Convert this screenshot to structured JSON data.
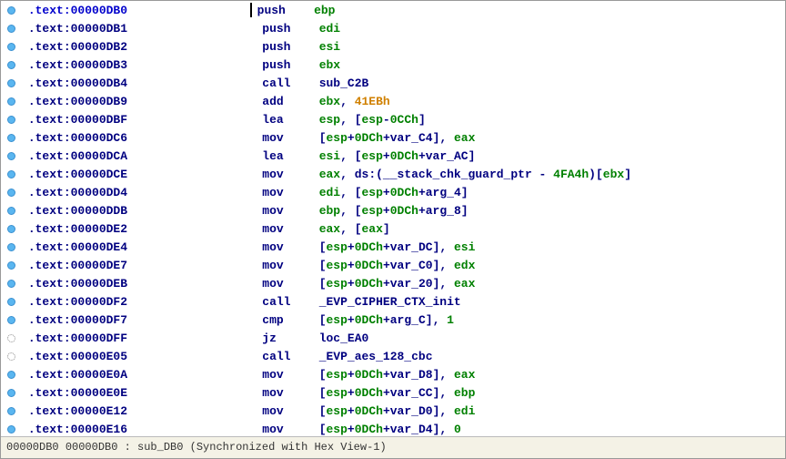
{
  "status": {
    "addr1": "00000DB0",
    "addr2": "00000DB0",
    "func": "sub_DB0",
    "sync": "(Synchronized with Hex View-1)"
  },
  "lines": [
    {
      "bp": "dot",
      "cursor": true,
      "addr": ".text:00000DB0",
      "op": "push",
      "args": [
        {
          "t": "reg",
          "v": "ebp"
        }
      ]
    },
    {
      "bp": "dot",
      "addr": ".text:00000DB1",
      "op": "push",
      "args": [
        {
          "t": "reg",
          "v": "edi"
        }
      ]
    },
    {
      "bp": "dot",
      "addr": ".text:00000DB2",
      "op": "push",
      "args": [
        {
          "t": "reg",
          "v": "esi"
        }
      ]
    },
    {
      "bp": "dot",
      "addr": ".text:00000DB3",
      "op": "push",
      "args": [
        {
          "t": "reg",
          "v": "ebx"
        }
      ]
    },
    {
      "bp": "dot",
      "addr": ".text:00000DB4",
      "op": "call",
      "args": [
        {
          "t": "name",
          "v": "sub_C2B"
        }
      ]
    },
    {
      "bp": "dot",
      "addr": ".text:00000DB9",
      "op": "add",
      "args": [
        {
          "t": "reg",
          "v": "ebx"
        },
        {
          "t": "p",
          "v": ", "
        },
        {
          "t": "orange",
          "v": "41EBh"
        }
      ]
    },
    {
      "bp": "dot",
      "addr": ".text:00000DBF",
      "op": "lea",
      "args": [
        {
          "t": "reg",
          "v": "esp"
        },
        {
          "t": "p",
          "v": ", ["
        },
        {
          "t": "reg",
          "v": "esp"
        },
        {
          "t": "p",
          "v": "-"
        },
        {
          "t": "num",
          "v": "0CCh"
        },
        {
          "t": "p",
          "v": "]"
        }
      ]
    },
    {
      "bp": "dot",
      "addr": ".text:00000DC6",
      "op": "mov",
      "args": [
        {
          "t": "p",
          "v": "["
        },
        {
          "t": "reg",
          "v": "esp"
        },
        {
          "t": "p",
          "v": "+"
        },
        {
          "t": "num",
          "v": "0DCh"
        },
        {
          "t": "p",
          "v": "+"
        },
        {
          "t": "name",
          "v": "var_C4"
        },
        {
          "t": "p",
          "v": "], "
        },
        {
          "t": "reg",
          "v": "eax"
        }
      ]
    },
    {
      "bp": "dot",
      "addr": ".text:00000DCA",
      "op": "lea",
      "args": [
        {
          "t": "reg",
          "v": "esi"
        },
        {
          "t": "p",
          "v": ", ["
        },
        {
          "t": "reg",
          "v": "esp"
        },
        {
          "t": "p",
          "v": "+"
        },
        {
          "t": "num",
          "v": "0DCh"
        },
        {
          "t": "p",
          "v": "+"
        },
        {
          "t": "name",
          "v": "var_AC"
        },
        {
          "t": "p",
          "v": "]"
        }
      ]
    },
    {
      "bp": "dot",
      "addr": ".text:00000DCE",
      "op": "mov",
      "args": [
        {
          "t": "reg",
          "v": "eax"
        },
        {
          "t": "p",
          "v": ", "
        },
        {
          "t": "kw",
          "v": "ds"
        },
        {
          "t": "p",
          "v": ":("
        },
        {
          "t": "name",
          "v": "__stack_chk_guard_ptr"
        },
        {
          "t": "p",
          "v": " - "
        },
        {
          "t": "num",
          "v": "4FA4h"
        },
        {
          "t": "p",
          "v": ")["
        },
        {
          "t": "reg",
          "v": "ebx"
        },
        {
          "t": "p",
          "v": "]"
        }
      ]
    },
    {
      "bp": "dot",
      "addr": ".text:00000DD4",
      "op": "mov",
      "args": [
        {
          "t": "reg",
          "v": "edi"
        },
        {
          "t": "p",
          "v": ", ["
        },
        {
          "t": "reg",
          "v": "esp"
        },
        {
          "t": "p",
          "v": "+"
        },
        {
          "t": "num",
          "v": "0DCh"
        },
        {
          "t": "p",
          "v": "+"
        },
        {
          "t": "name",
          "v": "arg_4"
        },
        {
          "t": "p",
          "v": "]"
        }
      ]
    },
    {
      "bp": "dot",
      "addr": ".text:00000DDB",
      "op": "mov",
      "args": [
        {
          "t": "reg",
          "v": "ebp"
        },
        {
          "t": "p",
          "v": ", ["
        },
        {
          "t": "reg",
          "v": "esp"
        },
        {
          "t": "p",
          "v": "+"
        },
        {
          "t": "num",
          "v": "0DCh"
        },
        {
          "t": "p",
          "v": "+"
        },
        {
          "t": "name",
          "v": "arg_8"
        },
        {
          "t": "p",
          "v": "]"
        }
      ]
    },
    {
      "bp": "dot",
      "addr": ".text:00000DE2",
      "op": "mov",
      "args": [
        {
          "t": "reg",
          "v": "eax"
        },
        {
          "t": "p",
          "v": ", ["
        },
        {
          "t": "reg",
          "v": "eax"
        },
        {
          "t": "p",
          "v": "]"
        }
      ]
    },
    {
      "bp": "dot",
      "addr": ".text:00000DE4",
      "op": "mov",
      "args": [
        {
          "t": "p",
          "v": "["
        },
        {
          "t": "reg",
          "v": "esp"
        },
        {
          "t": "p",
          "v": "+"
        },
        {
          "t": "num",
          "v": "0DCh"
        },
        {
          "t": "p",
          "v": "+"
        },
        {
          "t": "name",
          "v": "var_DC"
        },
        {
          "t": "p",
          "v": "], "
        },
        {
          "t": "reg",
          "v": "esi"
        }
      ]
    },
    {
      "bp": "dot",
      "addr": ".text:00000DE7",
      "op": "mov",
      "args": [
        {
          "t": "p",
          "v": "["
        },
        {
          "t": "reg",
          "v": "esp"
        },
        {
          "t": "p",
          "v": "+"
        },
        {
          "t": "num",
          "v": "0DCh"
        },
        {
          "t": "p",
          "v": "+"
        },
        {
          "t": "name",
          "v": "var_C0"
        },
        {
          "t": "p",
          "v": "], "
        },
        {
          "t": "reg",
          "v": "edx"
        }
      ]
    },
    {
      "bp": "dot",
      "addr": ".text:00000DEB",
      "op": "mov",
      "args": [
        {
          "t": "p",
          "v": "["
        },
        {
          "t": "reg",
          "v": "esp"
        },
        {
          "t": "p",
          "v": "+"
        },
        {
          "t": "num",
          "v": "0DCh"
        },
        {
          "t": "p",
          "v": "+"
        },
        {
          "t": "name",
          "v": "var_20"
        },
        {
          "t": "p",
          "v": "], "
        },
        {
          "t": "reg",
          "v": "eax"
        }
      ]
    },
    {
      "bp": "dot",
      "addr": ".text:00000DF2",
      "op": "call",
      "args": [
        {
          "t": "name",
          "v": "_EVP_CIPHER_CTX_init"
        }
      ]
    },
    {
      "bp": "dot",
      "addr": ".text:00000DF7",
      "op": "cmp",
      "args": [
        {
          "t": "p",
          "v": "["
        },
        {
          "t": "reg",
          "v": "esp"
        },
        {
          "t": "p",
          "v": "+"
        },
        {
          "t": "num",
          "v": "0DCh"
        },
        {
          "t": "p",
          "v": "+"
        },
        {
          "t": "name",
          "v": "arg_C"
        },
        {
          "t": "p",
          "v": "], "
        },
        {
          "t": "num",
          "v": "1"
        }
      ]
    },
    {
      "bp": "outline",
      "addr": ".text:00000DFF",
      "op": "jz",
      "args": [
        {
          "t": "name",
          "v": "loc_EA0"
        }
      ]
    },
    {
      "bp": "outline",
      "addr": ".text:00000E05",
      "op": "call",
      "args": [
        {
          "t": "name",
          "v": "_EVP_aes_128_cbc"
        }
      ]
    },
    {
      "bp": "dot",
      "addr": ".text:00000E0A",
      "op": "mov",
      "args": [
        {
          "t": "p",
          "v": "["
        },
        {
          "t": "reg",
          "v": "esp"
        },
        {
          "t": "p",
          "v": "+"
        },
        {
          "t": "num",
          "v": "0DCh"
        },
        {
          "t": "p",
          "v": "+"
        },
        {
          "t": "name",
          "v": "var_D8"
        },
        {
          "t": "p",
          "v": "], "
        },
        {
          "t": "reg",
          "v": "eax"
        }
      ]
    },
    {
      "bp": "dot",
      "addr": ".text:00000E0E",
      "op": "mov",
      "args": [
        {
          "t": "p",
          "v": "["
        },
        {
          "t": "reg",
          "v": "esp"
        },
        {
          "t": "p",
          "v": "+"
        },
        {
          "t": "num",
          "v": "0DCh"
        },
        {
          "t": "p",
          "v": "+"
        },
        {
          "t": "name",
          "v": "var_CC"
        },
        {
          "t": "p",
          "v": "], "
        },
        {
          "t": "reg",
          "v": "ebp"
        }
      ]
    },
    {
      "bp": "dot",
      "addr": ".text:00000E12",
      "op": "mov",
      "args": [
        {
          "t": "p",
          "v": "["
        },
        {
          "t": "reg",
          "v": "esp"
        },
        {
          "t": "p",
          "v": "+"
        },
        {
          "t": "num",
          "v": "0DCh"
        },
        {
          "t": "p",
          "v": "+"
        },
        {
          "t": "name",
          "v": "var_D0"
        },
        {
          "t": "p",
          "v": "], "
        },
        {
          "t": "reg",
          "v": "edi"
        }
      ]
    },
    {
      "bp": "dot",
      "addr": ".text:00000E16",
      "op": "mov",
      "args": [
        {
          "t": "p",
          "v": "["
        },
        {
          "t": "reg",
          "v": "esp"
        },
        {
          "t": "p",
          "v": "+"
        },
        {
          "t": "num",
          "v": "0DCh"
        },
        {
          "t": "p",
          "v": "+"
        },
        {
          "t": "name",
          "v": "var_D4"
        },
        {
          "t": "p",
          "v": "], "
        },
        {
          "t": "num",
          "v": "0"
        }
      ]
    }
  ]
}
